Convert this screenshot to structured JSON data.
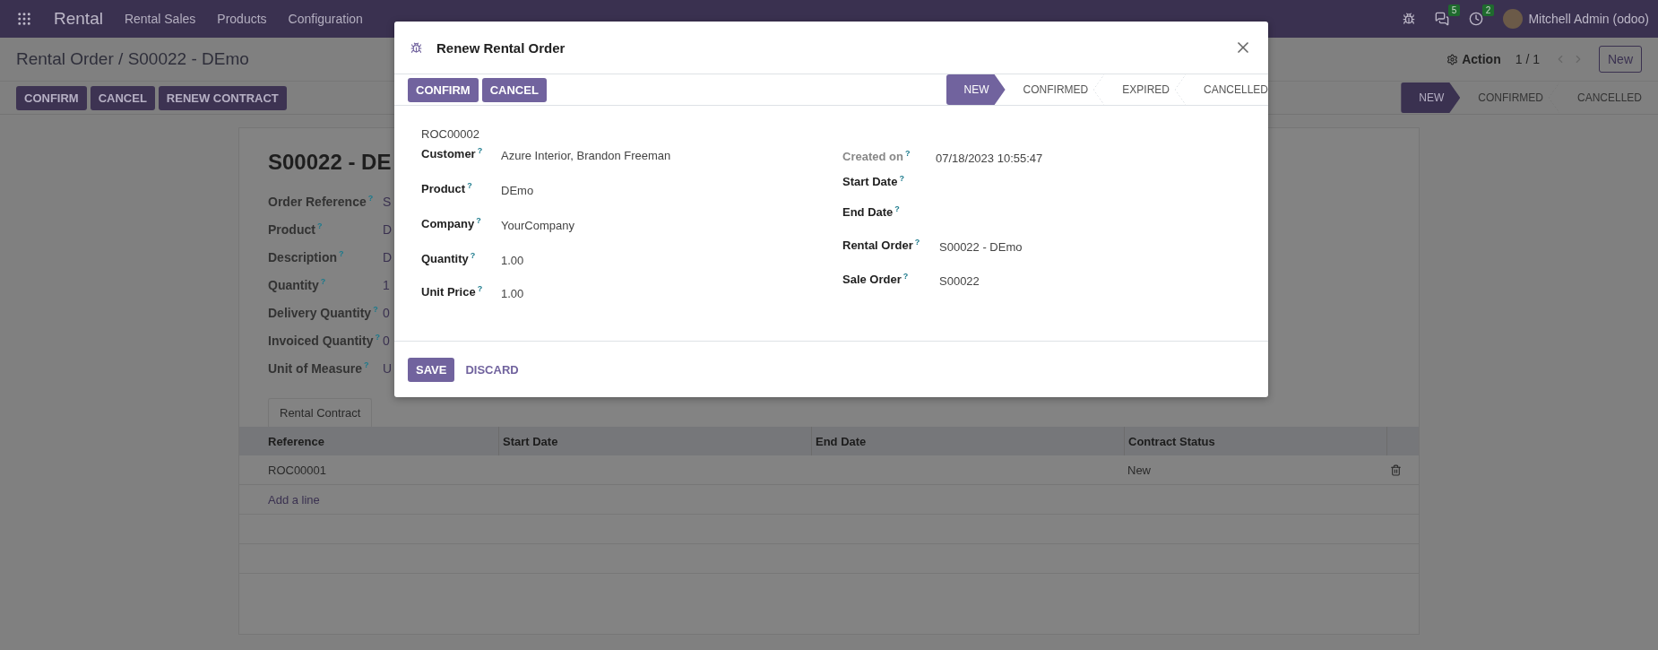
{
  "navbar": {
    "app_name": "Rental",
    "menu": [
      "Rental Sales",
      "Products",
      "Configuration"
    ],
    "chat_badge": "5",
    "activity_badge": "2",
    "user": "Mitchell Admin (odoo)"
  },
  "breadcrumb": {
    "parent": "Rental Order",
    "separator": "/",
    "current": "S00022 - DEmo"
  },
  "action_menu": "Action",
  "pager": "1 / 1",
  "new_button": "New",
  "actions": [
    "CONFIRM",
    "CANCEL",
    "RENEW CONTRACT"
  ],
  "statusbar": [
    {
      "label": "NEW",
      "selected": true
    },
    {
      "label": "CONFIRMED",
      "selected": false
    },
    {
      "label": "CANCELLED",
      "selected": false
    }
  ],
  "sheet": {
    "title": "S00022 - DE",
    "fields": [
      {
        "label": "Order Reference$^{?}$",
        "value": "S"
      },
      {
        "label": "Product$^{?}$",
        "value": "D"
      },
      {
        "label": "Description$^{?}$",
        "value": "D"
      },
      {
        "label": "Quantity$^{?}$",
        "value": "1"
      },
      {
        "label": "Delivery Quantity$^{?}$",
        "value": "0"
      },
      {
        "label": "Invoiced Quantity$^{?}$",
        "value": "0"
      },
      {
        "label": "Unit of Measure$^{?}$",
        "value": "U"
      }
    ],
    "tabs": [
      {
        "label": "Rental Contract",
        "selected": true
      }
    ],
    "table": {
      "columns": [
        "Reference",
        "Start Date",
        "End Date",
        "Contract Status"
      ],
      "rows": [
        {
          "cells": [
            "ROC00001",
            "",
            "",
            "New"
          ]
        }
      ],
      "add_line": "Add a line"
    }
  },
  "dialog": {
    "title": "Renew Rental Order",
    "buttons": [
      "CONFIRM",
      "CANCEL"
    ],
    "statusbar": [
      {
        "label": "NEW",
        "selected": true
      },
      {
        "label": "CONFIRMED",
        "selected": false
      },
      {
        "label": "EXPIRED",
        "selected": false
      },
      {
        "label": "CANCELLED",
        "selected": false
      }
    ],
    "reference": "ROC00002",
    "left_fields": [
      {
        "label": "Customer$^{?}$",
        "value": "Azure Interior, Brandon Freeman"
      },
      {
        "label": "Product$^{?}$",
        "value": "DEmo"
      },
      {
        "label": "Company$^{?}$",
        "value": "YourCompany"
      },
      {
        "label": "Quantity$^{?}$",
        "value": "1.00"
      },
      {
        "label": "Unit Price$^{?}$",
        "value": "1.00"
      }
    ],
    "right_fields": [
      {
        "label": "Created on$^{?}$",
        "value": "07/18/2023 10:55:47",
        "readonly": true
      },
      {
        "label": "Start Date$^{?}$",
        "readonly": false
      },
      {
        "label": "End Date$^{?}$",
        "readonly": false
      },
      {
        "label": "Rental Order$^{?}$",
        "value": "S00022 - DEmo",
        "readonly": false
      },
      {
        "label": "Sale Order$^{?}$",
        "value": "S00022",
        "readonly": false
      }
    ],
    "save": "SAVE",
    "discard": "DISCARD"
  }
}
